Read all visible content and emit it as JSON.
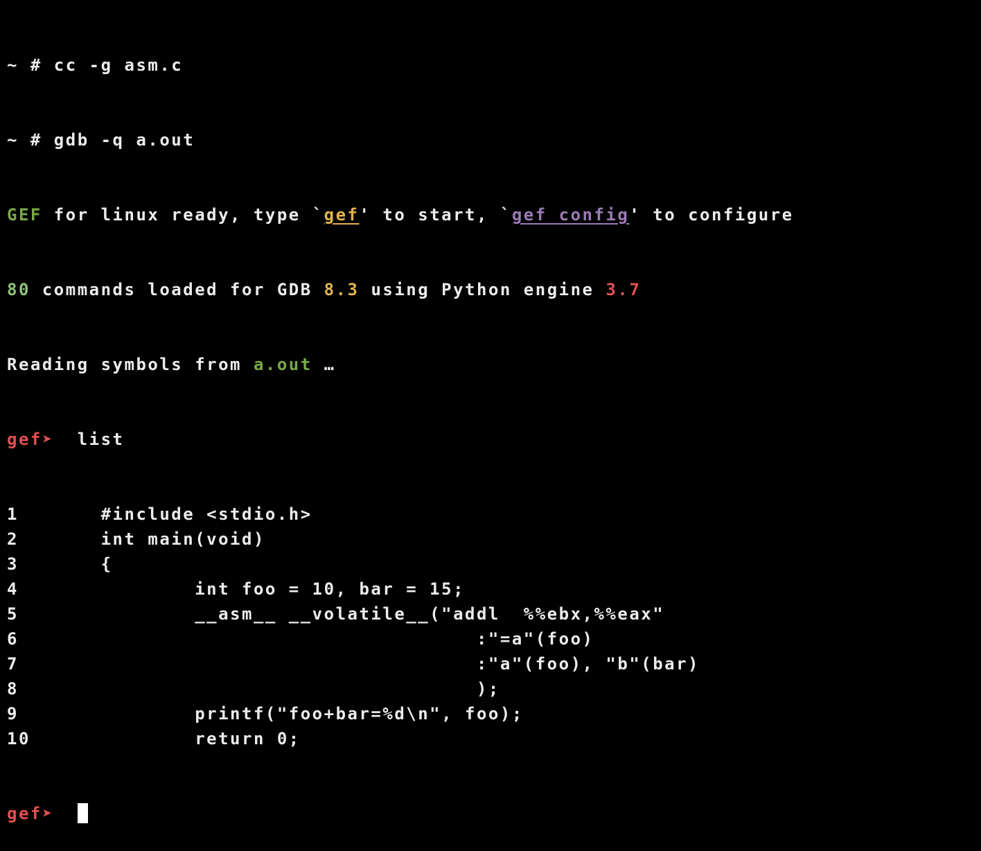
{
  "terminal": {
    "lines": {
      "l1": {
        "prompt": "~ # ",
        "cmd": "cc -g asm.c"
      },
      "l2": {
        "prompt": "~ # ",
        "cmd": "gdb -q a.out"
      },
      "l3": {
        "gef": "GEF",
        "t1": " for linux ready, type `",
        "gef2": "gef",
        "t2": "' to start, `",
        "gefconfig": "gef config",
        "t3": "' to configure"
      },
      "l4": {
        "n80": "80",
        "t1": " commands loaded for GDB ",
        "gdbver": "8.3",
        "t2": " using Python engine ",
        "pyver": "3.7"
      },
      "l5": {
        "t1": "Reading symbols from ",
        "file": "a.out",
        "t2": " …"
      },
      "l6": {
        "prompt": "gef➤ ",
        "cmd": " list"
      }
    },
    "listing": [
      {
        "num": "1",
        "code": "\t#include <stdio.h>"
      },
      {
        "num": "2",
        "code": "\tint main(void)"
      },
      {
        "num": "3",
        "code": "\t{"
      },
      {
        "num": "4",
        "code": "\t\tint foo = 10, bar = 15;"
      },
      {
        "num": "5",
        "code": "\t\t__asm__ __volatile__(\"addl  %%ebx,%%eax\""
      },
      {
        "num": "6",
        "code": "\t\t\t\t\t:\"=a\"(foo)"
      },
      {
        "num": "7",
        "code": "\t\t\t\t\t:\"a\"(foo), \"b\"(bar)"
      },
      {
        "num": "8",
        "code": "\t\t\t\t\t);"
      },
      {
        "num": "9",
        "code": "\t\tprintf(\"foo+bar=%d\\n\", foo);"
      },
      {
        "num": "10",
        "code": "\t\treturn 0;"
      }
    ],
    "final_prompt": "gef➤ "
  }
}
